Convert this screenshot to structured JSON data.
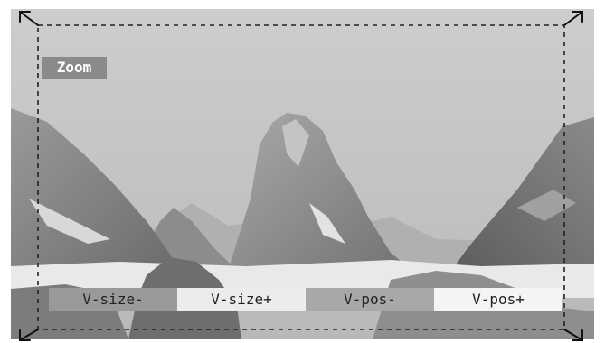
{
  "zoom_label": "Zoom",
  "osd_buttons": [
    {
      "label": "V-size-"
    },
    {
      "label": "V-size+"
    },
    {
      "label": "V-pos-"
    },
    {
      "label": "V-pos+"
    }
  ],
  "colors": {
    "label_bg": "#8a8a8a",
    "dashed_frame": "#222222"
  },
  "icons": [
    "arrow-top-left-icon",
    "arrow-top-right-icon",
    "arrow-bottom-left-icon",
    "arrow-bottom-right-icon"
  ]
}
